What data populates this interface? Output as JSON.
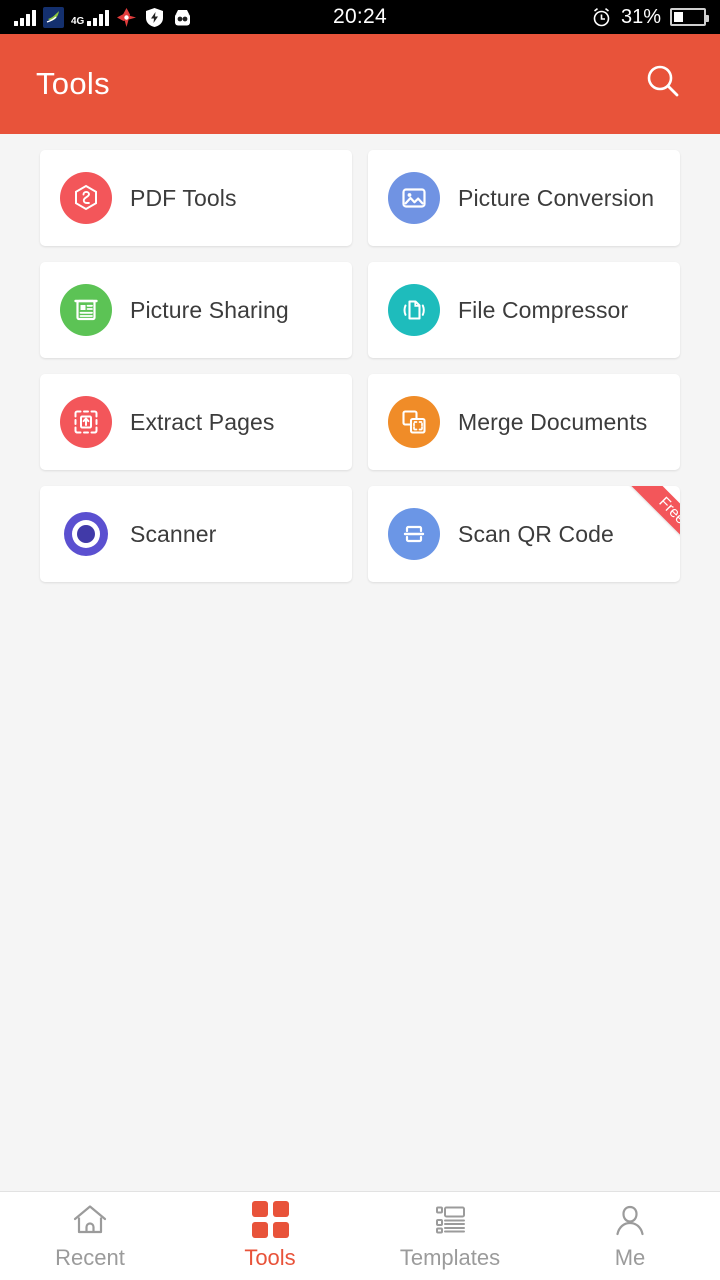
{
  "status_bar": {
    "time": "20:24",
    "battery_percent": "31%",
    "battery_level": 31,
    "network_label": "4G",
    "icons": [
      "signal-bars-icon",
      "app-leaf-icon",
      "signal-4g-icon",
      "location-icon",
      "shield-icon",
      "robot-icon",
      "alarm-icon",
      "battery-icon"
    ]
  },
  "app_bar": {
    "title": "Tools",
    "search_icon": "search-icon"
  },
  "tools": [
    {
      "label": "PDF Tools",
      "icon": "pdf-tools-icon",
      "color": "#f3565a",
      "badge": ""
    },
    {
      "label": "Picture Conversion",
      "icon": "picture-conversion-icon",
      "color": "#7093e3",
      "badge": ""
    },
    {
      "label": "Picture Sharing",
      "icon": "picture-sharing-icon",
      "color": "#5cc355",
      "badge": ""
    },
    {
      "label": "File Compressor",
      "icon": "file-compressor-icon",
      "color": "#1ebcbc",
      "badge": ""
    },
    {
      "label": "Extract Pages",
      "icon": "extract-pages-icon",
      "color": "#f3565a",
      "badge": ""
    },
    {
      "label": "Merge Documents",
      "icon": "merge-documents-icon",
      "color": "#f08c28",
      "badge": ""
    },
    {
      "label": "Scanner",
      "icon": "scanner-icon",
      "color": "#5b50d0",
      "badge": ""
    },
    {
      "label": "Scan QR Code",
      "icon": "scan-qr-code-icon",
      "color": "#6b96e6",
      "badge": "Free"
    }
  ],
  "bottom_nav": {
    "active": "Tools",
    "items": [
      {
        "label": "Recent",
        "icon": "home-icon"
      },
      {
        "label": "Tools",
        "icon": "grid-icon"
      },
      {
        "label": "Templates",
        "icon": "templates-icon"
      },
      {
        "label": "Me",
        "icon": "person-icon"
      }
    ]
  },
  "theme": {
    "accent": "#e8533a",
    "background": "#f5f5f5",
    "card": "#ffffff",
    "text": "#3c3c3c",
    "muted": "#9b9b9b"
  }
}
